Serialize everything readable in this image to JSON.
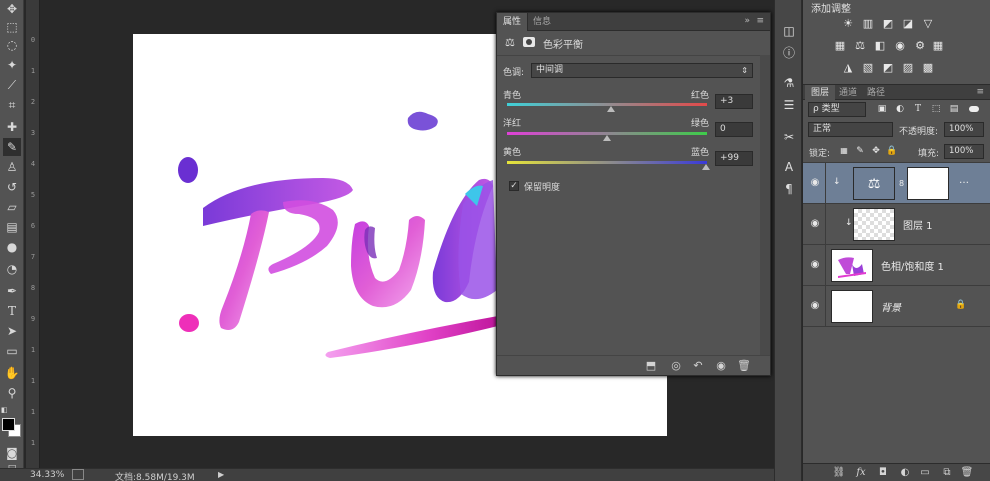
{
  "status": {
    "zoom": "34.33%",
    "doc": "文档:8.58M/19.3M"
  },
  "properties": {
    "tabs": [
      "属性",
      "信息"
    ],
    "title": "色彩平衡",
    "tone_label": "色调:",
    "tone_value": "中间调",
    "sliders": [
      {
        "left": "青色",
        "right": "红色",
        "value": "+3",
        "level": 0.515
      },
      {
        "left": "洋红",
        "right": "绿色",
        "value": "0",
        "level": 0.5
      },
      {
        "left": "黄色",
        "right": "蓝色",
        "value": "+99",
        "level": 0.995
      }
    ],
    "preserve_label": "保留明度",
    "preserve_checked": true
  },
  "adjustments": {
    "title": "添加调整"
  },
  "layers": {
    "tabs": [
      "图层",
      "通道",
      "路径"
    ],
    "kind_label": "ρ 类型",
    "blend_mode": "正常",
    "opacity_label": "不透明度:",
    "opacity_value": "100%",
    "lock_label": "锁定:",
    "fill_label": "填充:",
    "fill_value": "100%",
    "items": [
      {
        "name": "",
        "type": "color-balance-adjustment",
        "selected": true
      },
      {
        "name": "图层 1",
        "type": "transparent-clipped"
      },
      {
        "name": "色相/饱和度 1",
        "type": "image"
      },
      {
        "name": "背景",
        "type": "background",
        "locked": true
      }
    ],
    "footer_icons": [
      "link-icon",
      "fx-icon",
      "mask-icon",
      "adjustment-icon",
      "group-icon",
      "new-layer-icon",
      "trash-icon"
    ]
  },
  "colors": {
    "panel": "#535353",
    "selected_layer": "#6e7f96",
    "art_purple": "#9b3fd8",
    "art_magenta": "#e23bd0"
  },
  "ruler_ticks": [
    "0",
    "1",
    "2",
    "3",
    "4",
    "5",
    "6",
    "7",
    "8",
    "9",
    "1",
    "1",
    "1",
    "1"
  ]
}
